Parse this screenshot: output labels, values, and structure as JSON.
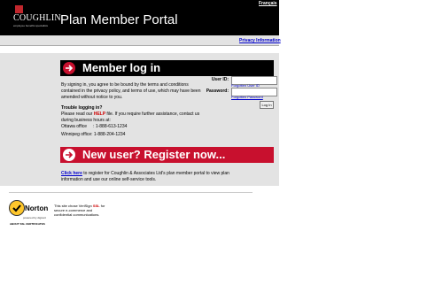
{
  "header": {
    "logo_name": "COUGHLIN",
    "logo_tagline": "employee benefits specialists",
    "portal_title": "Plan Member Portal",
    "language_link": "Français"
  },
  "top_bar": {
    "privacy_link": "Privacy Information"
  },
  "login": {
    "banner_title": "Member log in",
    "terms_text": "By signing in, you agree to be bound by the terms and conditions contained in the privacy policy, and terms of use, which may have been amended without notice to you.",
    "trouble_heading": "Trouble logging in?",
    "help_prefix": "Please read our ",
    "help_link": "HELP",
    "help_suffix": " file. If you require further assistance, contact us during business hours at:",
    "office_ottawa": "Ottawa office     : 1-888-613-1234",
    "office_winnipeg": "Winnipeg office: 1-888-204-1234",
    "userid_label": "User ID:",
    "userid_value": "",
    "forgot_userid": "Forgotten User ID",
    "password_label": "Password:",
    "password_value": "",
    "forgot_password": "Forgotten Password",
    "login_button": "Log In"
  },
  "register": {
    "banner_title": "New user? Register now...",
    "click_here": "Click here",
    "register_text": " to register for Coughlin & Associates Ltd's plan member portal to view plan information and use our online self-service tools."
  },
  "seal": {
    "norton_name": "Norton",
    "powered_by": "powered by digicert",
    "about": "ABOUT SSL CERTIFICATES",
    "text_prefix": "This site chose VeriSign ",
    "ssl": "SSL",
    "text_suffix": " for secure e-commerce and confidential communications."
  },
  "colors": {
    "accent_red": "#c8102e",
    "header_black": "#000000",
    "panel_gray": "#e3e3e3",
    "link_blue": "#0000cc"
  },
  "icons": {
    "banner_arrow": "arrow-right-circle-icon",
    "norton_check": "checkmark-icon"
  }
}
